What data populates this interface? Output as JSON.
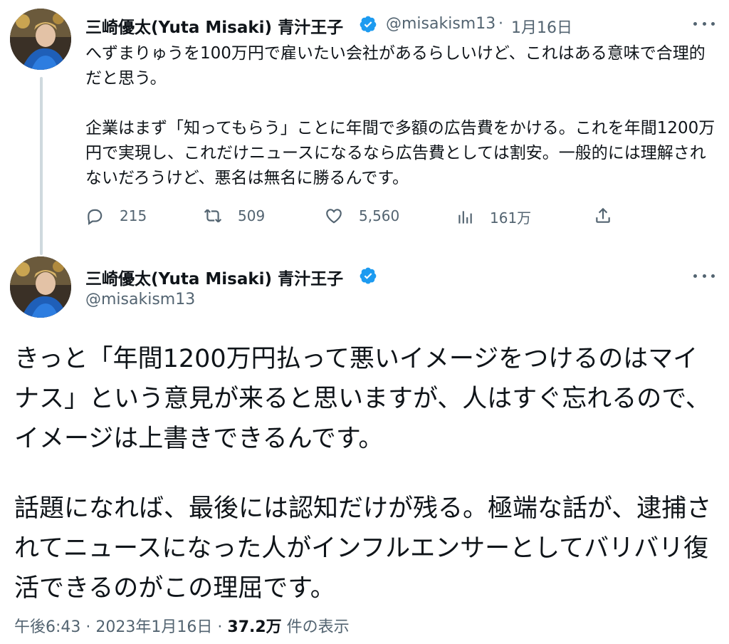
{
  "tweet1": {
    "author_name": "三崎優太(Yuta Misaki) 青汁王子",
    "handle": "@misakism13",
    "separator": "·",
    "date": "1月16日",
    "paragraphs": [
      "へずまりゅうを100万円で雇いたい会社があるらしいけど、これはある意味で合理的だと思う。",
      "企業はまず「知ってもらう」ことに年間で多額の広告費をかける。これを年間1200万円で実現し、これだけニュースになるなら広告費としては割安。一般的には理解されないだろうけど、悪名は無名に勝るんです。"
    ],
    "actions": {
      "replies": "215",
      "retweets": "509",
      "likes": "5,560",
      "views": "161万"
    }
  },
  "tweet2": {
    "author_name": "三崎優太(Yuta Misaki) 青汁王子",
    "handle": "@misakism13",
    "paragraphs": [
      "きっと「年間1200万円払って悪いイメージをつけるのはマイナス」という意見が来ると思いますが、人はすぐ忘れるので、イメージは上書きできるんです。",
      "話題になれば、最後には認知だけが残る。極端な話が、逮捕されてニュースになった人がインフルエンサーとしてバリバリ復活できるのがこの理屈です。"
    ],
    "time": "午後6:43",
    "sep1": "·",
    "full_date": "2023年1月16日",
    "sep2": "·",
    "view_count": "37.2万",
    "view_label": "件の表示"
  },
  "colors": {
    "verified": "#1d9bf0",
    "text": "#0f1419",
    "secondary": "#536471",
    "thread_line": "#cfd9de"
  },
  "icons": {
    "verified": "verified-badge-icon",
    "more": "more-icon",
    "reply": "reply-icon",
    "retweet": "retweet-icon",
    "like": "heart-icon",
    "views": "views-icon",
    "share": "share-icon"
  }
}
